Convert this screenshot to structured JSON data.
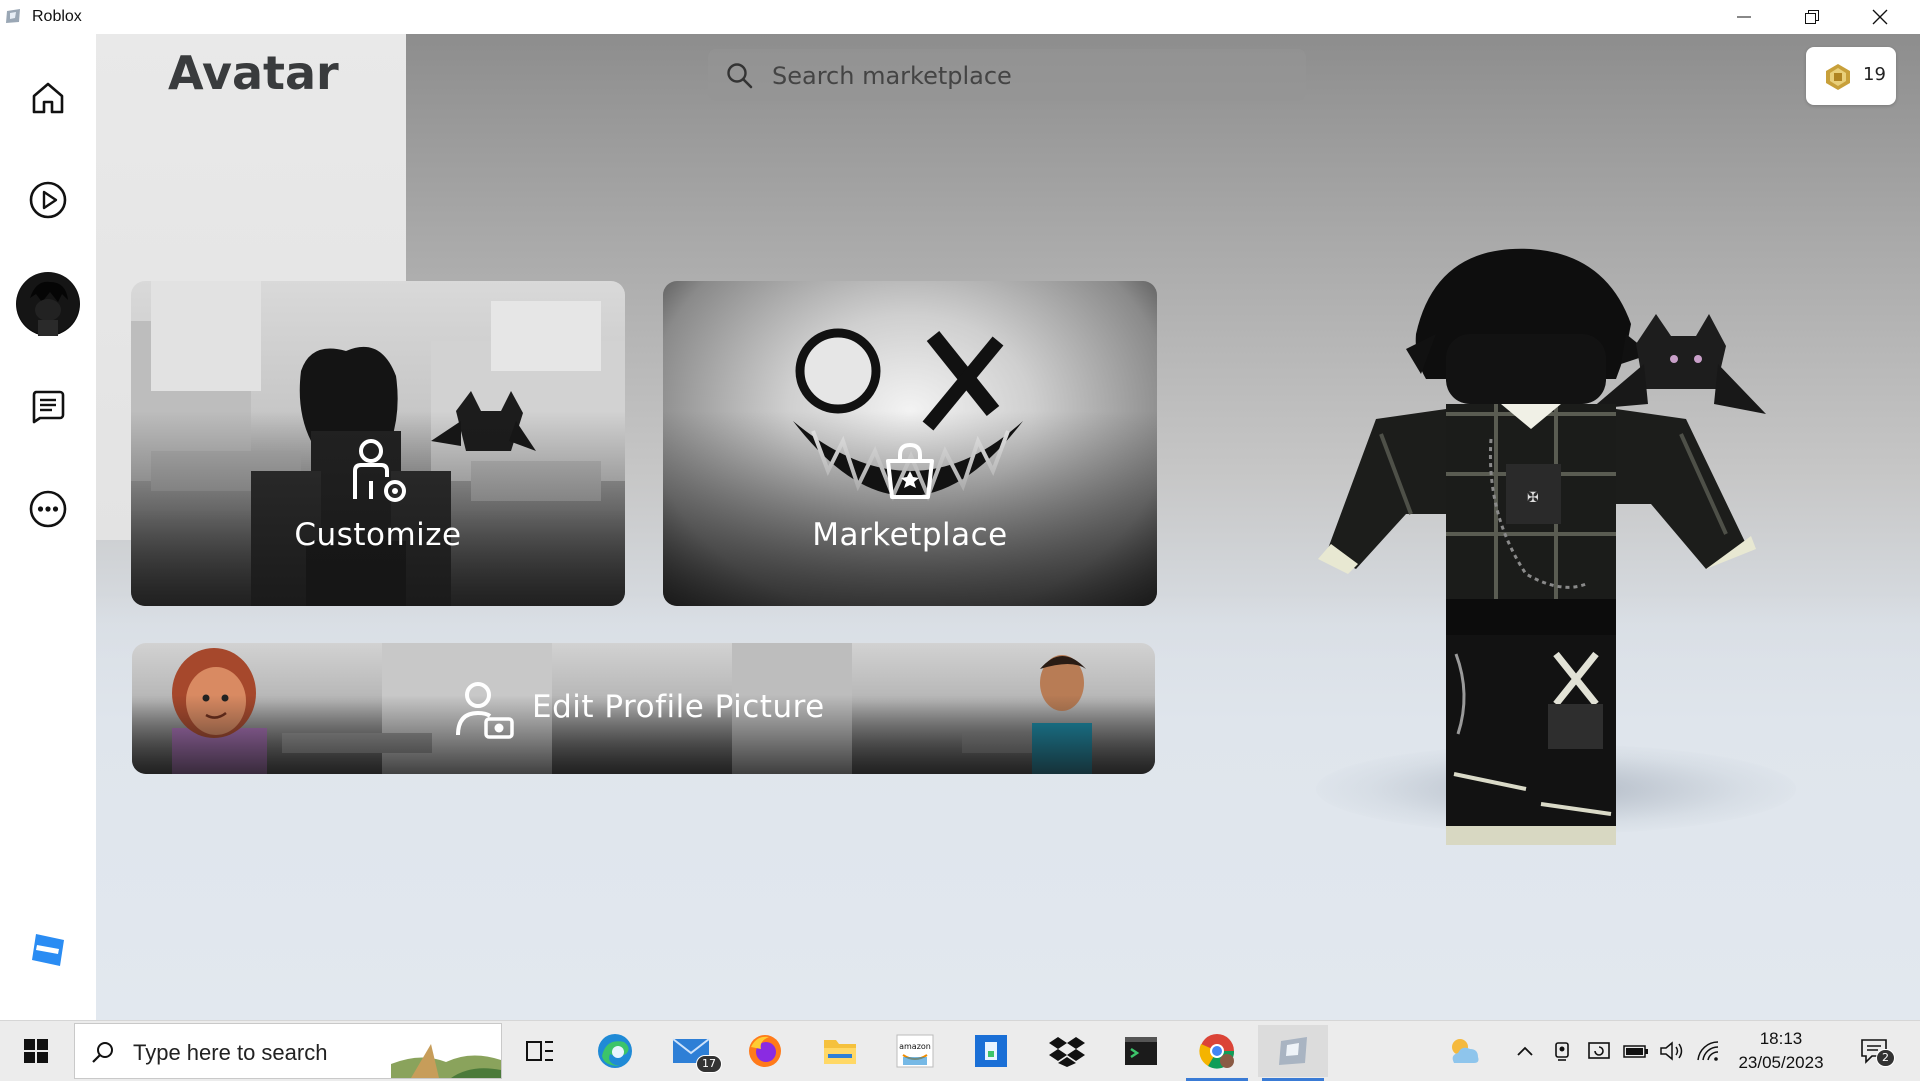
{
  "window": {
    "title": "Roblox"
  },
  "nav": {
    "items": [
      {
        "name": "home",
        "icon": "home-icon"
      },
      {
        "name": "discover",
        "icon": "play-icon"
      },
      {
        "name": "avatar",
        "icon": "avatar-thumbnail"
      },
      {
        "name": "chat",
        "icon": "chat-icon"
      },
      {
        "name": "more",
        "icon": "more-icon"
      }
    ],
    "logo": "roblox-logo-icon"
  },
  "header": {
    "title": "Avatar",
    "search_placeholder": "Search marketplace",
    "robux_count": "19"
  },
  "tiles": {
    "customize": "Customize",
    "marketplace": "Marketplace",
    "edit_profile": "Edit Profile Picture"
  },
  "taskbar": {
    "search_placeholder": "Type here to search",
    "mail_badge": "17",
    "time": "18:13",
    "date": "23/05/2023",
    "notification_badge": "2"
  },
  "colors": {
    "roblox_blue": "#2a8cf3",
    "title_text": "#393b3d",
    "robux_gold": "#c8a03a"
  }
}
